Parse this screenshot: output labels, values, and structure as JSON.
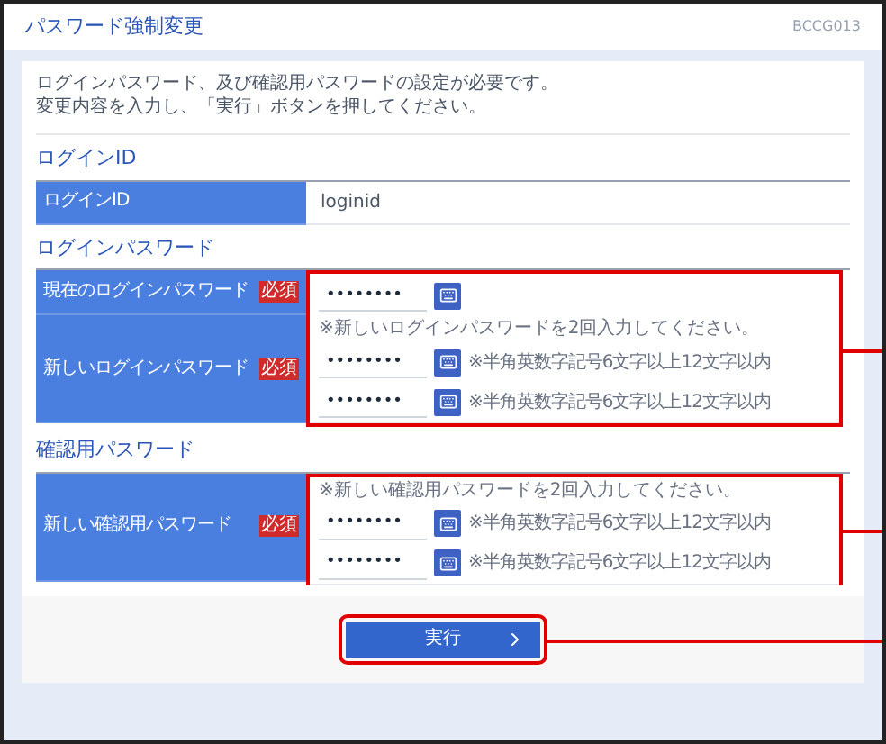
{
  "title": "パスワード強制変更",
  "screen_id": "BCCG013",
  "intro": [
    "ログインパスワード、及び確認用パスワードの設定が必要です。",
    "変更内容を入力し、「実行」ボタンを押してください。"
  ],
  "sections": [
    {
      "heading": "ログインID",
      "annotated": false,
      "rows": [
        {
          "kind": "text",
          "label": "ログインID",
          "value": "loginid"
        }
      ]
    },
    {
      "heading": "ログインパスワード",
      "annotated": true,
      "rows": [
        {
          "kind": "password",
          "label": "現在のログインパスワード",
          "required": "必須",
          "fields": [
            {
              "value": "••••••••"
            }
          ]
        },
        {
          "kind": "password",
          "label": "新しいログインパスワード",
          "required": "必須",
          "note": "※新しいログインパスワードを2回入力してください。",
          "fields": [
            {
              "value": "••••••••",
              "hint": "※半角英数字記号6文字以上12文字以内"
            },
            {
              "value": "••••••••",
              "hint": "※半角英数字記号6文字以上12文字以内"
            }
          ]
        }
      ]
    },
    {
      "heading": "確認用パスワード",
      "annotated": true,
      "rows": [
        {
          "kind": "password",
          "label": "新しい確認用パスワード",
          "required": "必須",
          "note": "※新しい確認用パスワードを2回入力してください。",
          "fields": [
            {
              "value": "••••••••",
              "hint": "※半角英数字記号6文字以上12文字以内"
            },
            {
              "value": "••••••••",
              "hint": "※半角英数字記号6文字以上12文字以内"
            }
          ]
        }
      ]
    }
  ],
  "submit": {
    "label": "実行",
    "annotated": true
  }
}
